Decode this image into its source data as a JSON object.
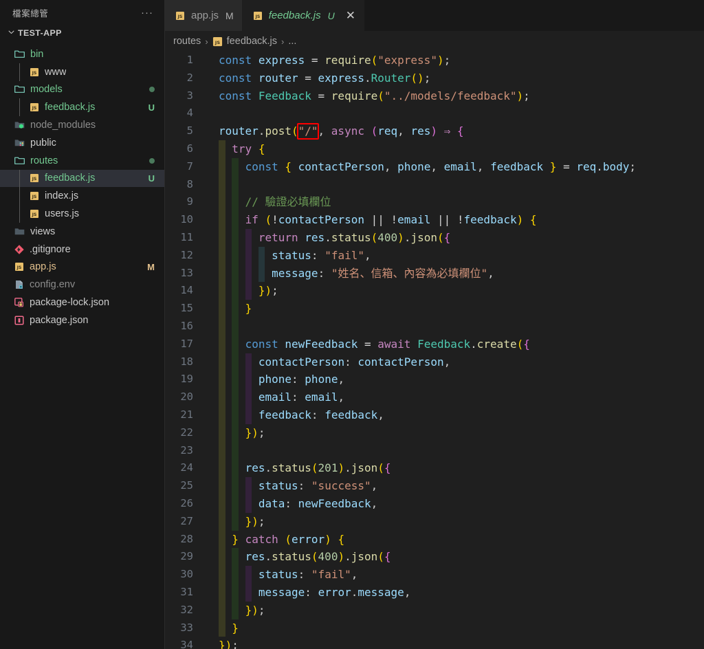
{
  "sidebar": {
    "title": "檔案總管",
    "more_label": "···",
    "root": {
      "label": "TEST-APP",
      "chevron": "chevron-down"
    },
    "items": [
      {
        "label": "bin",
        "kind": "folder-open",
        "depth": 1,
        "color": "green",
        "badge": "",
        "dot": false,
        "selected": false
      },
      {
        "label": "www",
        "kind": "js",
        "depth": 2,
        "color": "white",
        "badge": "",
        "dot": false,
        "selected": false
      },
      {
        "label": "models",
        "kind": "folder-open",
        "depth": 1,
        "color": "green",
        "badge": "",
        "dot": true,
        "selected": false
      },
      {
        "label": "feedback.js",
        "kind": "js",
        "depth": 2,
        "color": "green",
        "badge": "U",
        "dot": false,
        "selected": false
      },
      {
        "label": "node_modules",
        "kind": "folder-node",
        "depth": 1,
        "color": "dim",
        "badge": "",
        "dot": false,
        "selected": false
      },
      {
        "label": "public",
        "kind": "folder-public",
        "depth": 1,
        "color": "white",
        "badge": "",
        "dot": false,
        "selected": false
      },
      {
        "label": "routes",
        "kind": "folder-open",
        "depth": 1,
        "color": "green",
        "badge": "",
        "dot": true,
        "selected": false
      },
      {
        "label": "feedback.js",
        "kind": "js",
        "depth": 2,
        "color": "green",
        "badge": "U",
        "dot": false,
        "selected": true
      },
      {
        "label": "index.js",
        "kind": "js",
        "depth": 2,
        "color": "white",
        "badge": "",
        "dot": false,
        "selected": false
      },
      {
        "label": "users.js",
        "kind": "js",
        "depth": 2,
        "color": "white",
        "badge": "",
        "dot": false,
        "selected": false
      },
      {
        "label": "views",
        "kind": "folder-plain",
        "depth": 1,
        "color": "white",
        "badge": "",
        "dot": false,
        "selected": false
      },
      {
        "label": ".gitignore",
        "kind": "git",
        "depth": 1,
        "color": "white",
        "badge": "",
        "dot": false,
        "selected": false
      },
      {
        "label": "app.js",
        "kind": "js",
        "depth": 1,
        "color": "yellow",
        "badge": "M",
        "dot": false,
        "selected": false
      },
      {
        "label": "config.env",
        "kind": "env",
        "depth": 1,
        "color": "dim",
        "badge": "",
        "dot": false,
        "selected": false
      },
      {
        "label": "package-lock.json",
        "kind": "pkg-lock",
        "depth": 1,
        "color": "white",
        "badge": "",
        "dot": false,
        "selected": false
      },
      {
        "label": "package.json",
        "kind": "pkg",
        "depth": 1,
        "color": "white",
        "badge": "",
        "dot": false,
        "selected": false
      }
    ]
  },
  "tabs": [
    {
      "name": "app.js",
      "state": "M",
      "icon": "js-icon",
      "active": false,
      "closable": false
    },
    {
      "name": "feedback.js",
      "state": "U",
      "icon": "js-icon",
      "active": true,
      "closable": true
    }
  ],
  "breadcrumb": {
    "folder": "routes",
    "file": "feedback.js",
    "tail": "...",
    "separator": "›"
  },
  "editor": {
    "language": "javascript",
    "first_line": 1,
    "last_line": 34,
    "highlight": {
      "text": "\"/\"",
      "line": 5,
      "color": "#ff0000"
    },
    "lines": [
      {
        "n": 1,
        "guides": [],
        "code": "const express = require(\"express\");"
      },
      {
        "n": 2,
        "guides": [],
        "code": "const router = express.Router();"
      },
      {
        "n": 3,
        "guides": [],
        "code": "const Feedback = require(\"../models/feedback\");"
      },
      {
        "n": 4,
        "guides": [],
        "code": ""
      },
      {
        "n": 5,
        "guides": [],
        "code": "router.post(\"/\", async (req, res) => {"
      },
      {
        "n": 6,
        "guides": [
          1
        ],
        "code": "  try {"
      },
      {
        "n": 7,
        "guides": [
          1,
          2
        ],
        "code": "    const { contactPerson, phone, email, feedback } = req.body;"
      },
      {
        "n": 8,
        "guides": [
          1,
          2
        ],
        "code": ""
      },
      {
        "n": 9,
        "guides": [
          1,
          2
        ],
        "code": "    // 驗證必填欄位"
      },
      {
        "n": 10,
        "guides": [
          1,
          2
        ],
        "code": "    if (!contactPerson || !email || !feedback) {"
      },
      {
        "n": 11,
        "guides": [
          1,
          2,
          3
        ],
        "code": "      return res.status(400).json({"
      },
      {
        "n": 12,
        "guides": [
          1,
          2,
          3,
          4
        ],
        "code": "        status: \"fail\","
      },
      {
        "n": 13,
        "guides": [
          1,
          2,
          3,
          4
        ],
        "code": "        message: \"姓名、信箱、內容為必填欄位\","
      },
      {
        "n": 14,
        "guides": [
          1,
          2,
          3
        ],
        "code": "      });"
      },
      {
        "n": 15,
        "guides": [
          1,
          2
        ],
        "code": "    }"
      },
      {
        "n": 16,
        "guides": [
          1,
          2
        ],
        "code": ""
      },
      {
        "n": 17,
        "guides": [
          1,
          2
        ],
        "code": "    const newFeedback = await Feedback.create({"
      },
      {
        "n": 18,
        "guides": [
          1,
          2,
          3
        ],
        "code": "      contactPerson: contactPerson,"
      },
      {
        "n": 19,
        "guides": [
          1,
          2,
          3
        ],
        "code": "      phone: phone,"
      },
      {
        "n": 20,
        "guides": [
          1,
          2,
          3
        ],
        "code": "      email: email,"
      },
      {
        "n": 21,
        "guides": [
          1,
          2,
          3
        ],
        "code": "      feedback: feedback,"
      },
      {
        "n": 22,
        "guides": [
          1,
          2
        ],
        "code": "    });"
      },
      {
        "n": 23,
        "guides": [
          1,
          2
        ],
        "code": ""
      },
      {
        "n": 24,
        "guides": [
          1,
          2
        ],
        "code": "    res.status(201).json({"
      },
      {
        "n": 25,
        "guides": [
          1,
          2,
          3
        ],
        "code": "      status: \"success\","
      },
      {
        "n": 26,
        "guides": [
          1,
          2,
          3
        ],
        "code": "      data: newFeedback,"
      },
      {
        "n": 27,
        "guides": [
          1,
          2
        ],
        "code": "    });"
      },
      {
        "n": 28,
        "guides": [
          1
        ],
        "code": "  } catch (error) {"
      },
      {
        "n": 29,
        "guides": [
          1,
          2
        ],
        "code": "    res.status(400).json({"
      },
      {
        "n": 30,
        "guides": [
          1,
          2,
          3
        ],
        "code": "      status: \"fail\","
      },
      {
        "n": 31,
        "guides": [
          1,
          2,
          3
        ],
        "code": "      message: error.message,"
      },
      {
        "n": 32,
        "guides": [
          1,
          2
        ],
        "code": "    });"
      },
      {
        "n": 33,
        "guides": [
          1
        ],
        "code": "  }"
      },
      {
        "n": 34,
        "guides": [],
        "code": "});"
      }
    ]
  },
  "colors": {
    "sidebar_bg": "#181818",
    "editor_bg": "#1f1f1f",
    "tab_active_bg": "#1f1f1f",
    "tab_inactive_bg": "#2a2a2a",
    "selection_bg": "#2f3138",
    "accent_green": "#73c991",
    "modified_yellow": "#e2c08d",
    "highlight_red": "#ff0000"
  }
}
